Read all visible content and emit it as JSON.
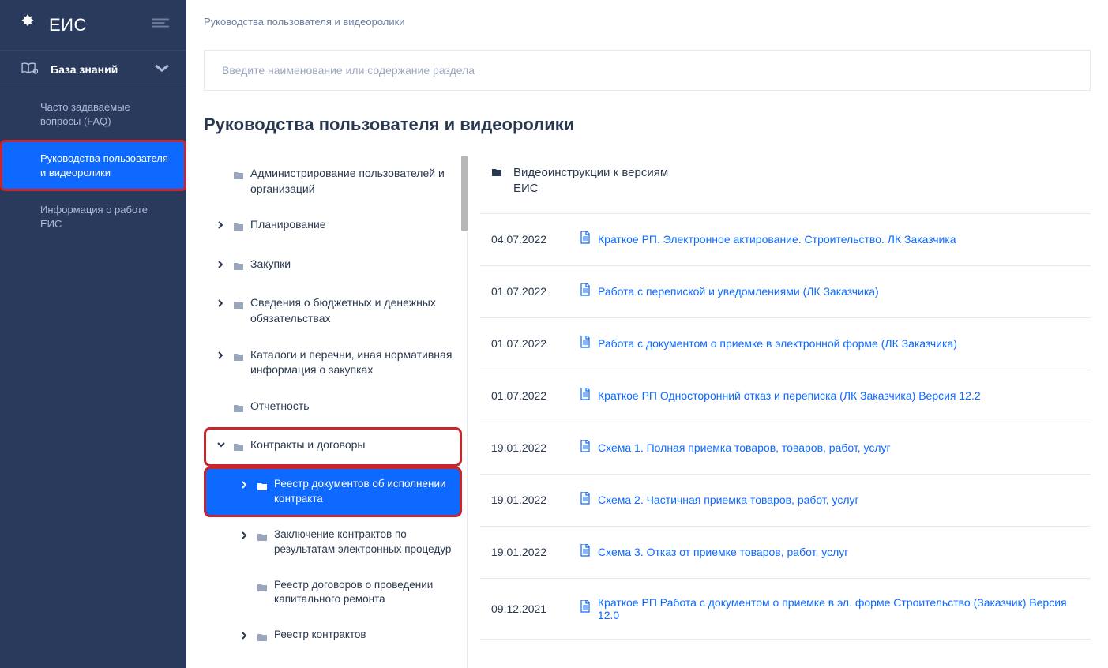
{
  "brand": {
    "title": "ЕИС"
  },
  "sidebar": {
    "kb_label": "База знаний",
    "items": [
      {
        "label": "Часто задаваемые вопросы (FAQ)",
        "active": false
      },
      {
        "label": "Руководства пользователя и видеоролики",
        "active": true
      },
      {
        "label": "Информация о работе ЕИС",
        "active": false
      }
    ]
  },
  "breadcrumb": "Руководства пользователя и видеоролики",
  "search": {
    "placeholder": "Введите наименование или содержание раздела"
  },
  "page_title": "Руководства пользователя и видеоролики",
  "tree": [
    {
      "label": "Администрирование пользователей и организаций",
      "has_chev": false,
      "open": false,
      "level": 0
    },
    {
      "label": "Планирование",
      "has_chev": true,
      "open": false,
      "level": 0
    },
    {
      "label": "Закупки",
      "has_chev": true,
      "open": false,
      "level": 0
    },
    {
      "label": "Сведения о бюджетных и денежных обязательствах",
      "has_chev": true,
      "open": false,
      "level": 0
    },
    {
      "label": "Каталоги и перечни, иная нормативная информация о закупках",
      "has_chev": true,
      "open": false,
      "level": 0
    },
    {
      "label": "Отчетность",
      "has_chev": false,
      "open": false,
      "level": 0
    },
    {
      "label": "Контракты и договоры",
      "has_chev": true,
      "open": true,
      "level": 0,
      "highlight": true
    },
    {
      "label": "Реестр документов об исполнении контракта",
      "has_chev": true,
      "open": false,
      "level": 1,
      "selected": true
    },
    {
      "label": "Заключение контрактов по результатам электронных процедур",
      "has_chev": true,
      "open": false,
      "level": 1
    },
    {
      "label": "Реестр договоров о проведении капитального ремонта",
      "has_chev": false,
      "open": false,
      "level": 1
    },
    {
      "label": "Реестр контрактов",
      "has_chev": true,
      "open": false,
      "level": 1
    }
  ],
  "list_header": "Видеоинструкции к версиям ЕИС",
  "docs": [
    {
      "date": "04.07.2022",
      "title": "Краткое РП. Электронное актирование. Строительство. ЛК Заказчика"
    },
    {
      "date": "01.07.2022",
      "title": "Работа с перепиской и уведомлениями (ЛК Заказчика)"
    },
    {
      "date": "01.07.2022",
      "title": "Работа с документом о приемке в электронной форме (ЛК Заказчика)"
    },
    {
      "date": "01.07.2022",
      "title": "Краткое РП Односторонний отказ и переписка (ЛК Заказчика) Версия 12.2"
    },
    {
      "date": "19.01.2022",
      "title": "Схема 1. Полная приемка товаров, товаров, работ, услуг"
    },
    {
      "date": "19.01.2022",
      "title": "Схема 2. Частичная приемка товаров, работ, услуг"
    },
    {
      "date": "19.01.2022",
      "title": "Схема 3. Отказ от приемке товаров, работ, услуг"
    },
    {
      "date": "09.12.2021",
      "title": "Краткое РП Работа с документом о приемке в эл. форме Строительство (Заказчик) Версия 12.0"
    }
  ]
}
